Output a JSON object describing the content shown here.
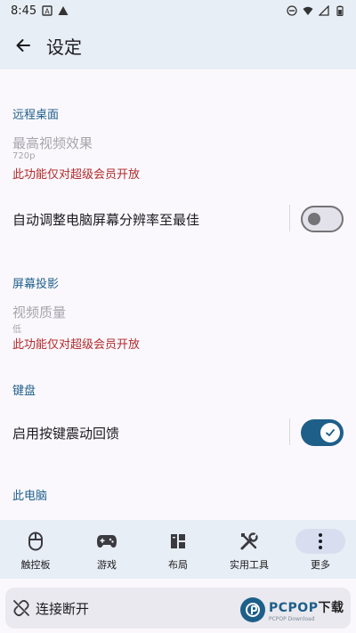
{
  "status_bar": {
    "time": "8:45"
  },
  "app_bar": {
    "title": "设定"
  },
  "sections": {
    "remote_desktop": {
      "header": "远程桌面",
      "video_effect_title": "最高视频效果",
      "video_effect_value": "720p",
      "warning": "此功能仅对超级会员开放",
      "auto_resolution_label": "自动调整电脑屏幕分辨率至最佳",
      "auto_resolution_on": false
    },
    "screen_cast": {
      "header": "屏幕投影",
      "video_quality_title": "视频质量",
      "video_quality_value": "低",
      "warning": "此功能仅对超级会员开放"
    },
    "keyboard": {
      "header": "键盘",
      "vibration_label": "启用按键震动回馈",
      "vibration_on": true
    },
    "this_pc": {
      "header": "此电脑"
    }
  },
  "bottom_nav": {
    "items": [
      {
        "label": "触控板",
        "icon": "mouse-icon"
      },
      {
        "label": "游戏",
        "icon": "gamepad-icon"
      },
      {
        "label": "布局",
        "icon": "layout-icon"
      },
      {
        "label": "实用工具",
        "icon": "tools-icon"
      },
      {
        "label": "更多",
        "icon": "more-vert-icon"
      }
    ],
    "active_index": 4
  },
  "connect_bar": {
    "label": "连接断开",
    "icon": "link-off-icon"
  },
  "watermark": {
    "brand": "PCPOP",
    "suffix": "下载",
    "sub": "PCPOP Download"
  },
  "colors": {
    "accent": "#1e5f8a",
    "warning": "#b02a2a",
    "bar_bg": "#e8eef5",
    "page_bg": "#fbf8fd"
  }
}
